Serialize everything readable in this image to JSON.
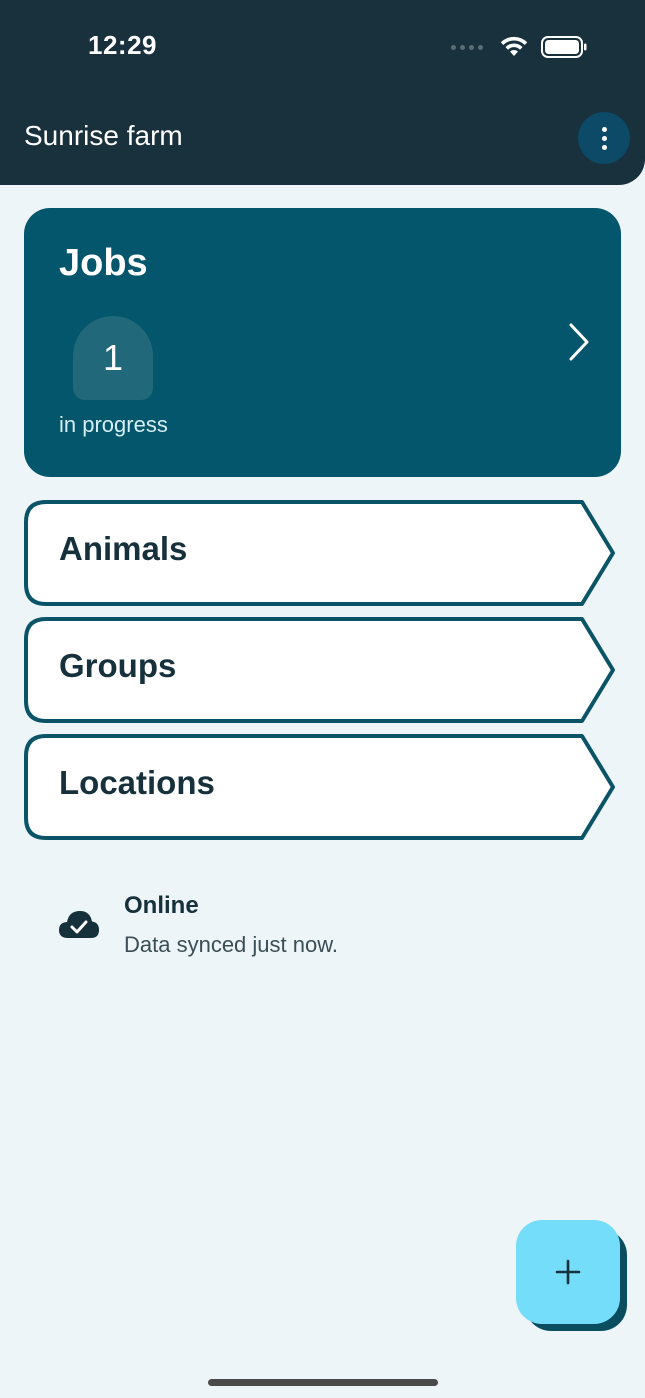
{
  "status_bar": {
    "time": "12:29"
  },
  "header": {
    "title": "Sunrise farm",
    "menu_icon": "more-vertical-icon"
  },
  "jobs_card": {
    "title": "Jobs",
    "count": "1",
    "status_label": "in progress",
    "chevron_icon": "chevron-right-icon"
  },
  "nav_cards": {
    "animals": "Animals",
    "groups": "Groups",
    "locations": "Locations"
  },
  "sync": {
    "title": "Online",
    "detail": "Data synced just now.",
    "icon": "cloud-check-icon"
  },
  "fab": {
    "icon": "plus-icon"
  },
  "colors": {
    "header_bg": "#19303d",
    "card_bg": "#03566b",
    "card_border": "#0b5468",
    "fab_bg": "#74ddfa",
    "page_bg": "#edf5f8"
  }
}
